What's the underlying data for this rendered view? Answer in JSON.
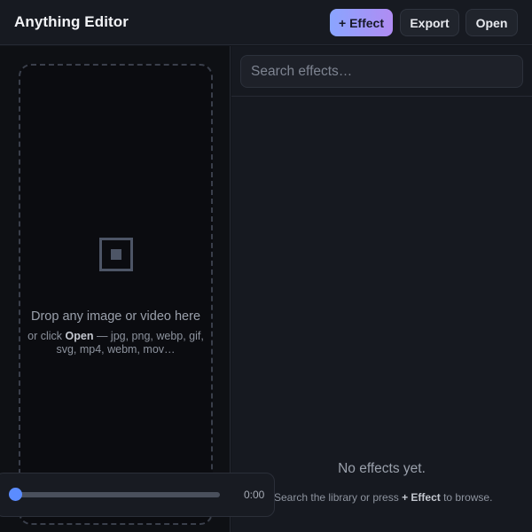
{
  "header": {
    "title": "Anything Editor",
    "effect_button": "+ Effect",
    "export_button": "Export",
    "open_button": "Open"
  },
  "dropzone": {
    "icon": "square-frame-icon",
    "title": "Drop any image or video here",
    "hint_prefix": "or click ",
    "hint_bold": "Open",
    "hint_suffix": " — jpg, png, webp, gif, svg, mp4, webm, mov…"
  },
  "effects": {
    "search_placeholder": "Search effects…",
    "empty_title": "No effects yet.",
    "empty_hint_prefix": "Search the library or press ",
    "empty_hint_bold": "+ Effect",
    "empty_hint_suffix": " to browse."
  },
  "player": {
    "time": "0:00",
    "progress": 0
  },
  "colors": {
    "accent_start": "#8aa5ff",
    "accent_end": "#b08cf3",
    "seek": "#5b8cff"
  }
}
